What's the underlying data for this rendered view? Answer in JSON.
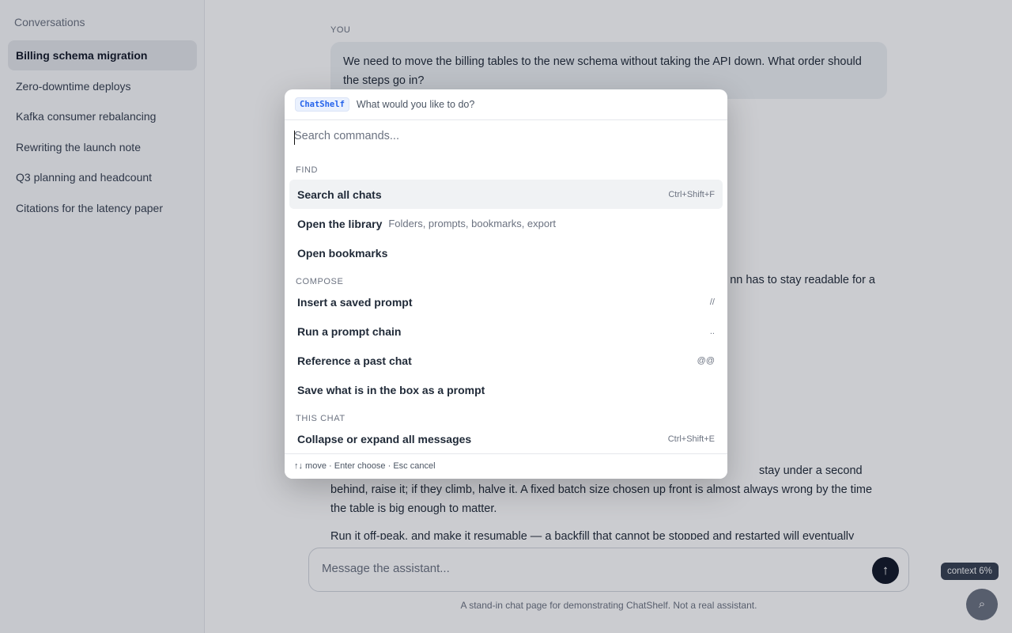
{
  "sidebar": {
    "heading": "Conversations",
    "items": [
      {
        "label": "Billing schema migration",
        "active": true
      },
      {
        "label": "Zero-downtime deploys"
      },
      {
        "label": "Kafka consumer rebalancing"
      },
      {
        "label": "Rewriting the launch note"
      },
      {
        "label": "Q3 planning and headcount"
      },
      {
        "label": "Citations for the latency paper"
      }
    ]
  },
  "chat": {
    "user_role": "YOU",
    "user_message": "We need to move the billing tables to the new schema without taking the API down. What order should the steps go in?",
    "reply_visible_fragment": "nn has to stay readable for a",
    "reply_paragraph_1": "stay under a second behind, raise it; if they climb, halve it. A fixed batch size chosen up front is almost always wrong by the time the table is big enough to matter.",
    "reply_paragraph_2": "Run it off-peak, and make it resumable — a backfill that cannot be stopped and restarted will eventually",
    "composer_placeholder": "Message the assistant...",
    "send_icon": "↑",
    "footer_note": "A stand-in chat page for demonstrating ChatShelf. Not a real assistant.",
    "context_label": "context 6%",
    "fab_icon": "⌕"
  },
  "palette": {
    "brand": "ChatShelf",
    "prompt": "What would you like to do?",
    "search_placeholder": "Search commands...",
    "groups": {
      "find": {
        "title": "FIND",
        "items": [
          {
            "label": "Search all chats",
            "shortcut": "Ctrl+Shift+F"
          },
          {
            "label": "Open the library",
            "hint": "Folders, prompts, bookmarks, export"
          },
          {
            "label": "Open bookmarks"
          }
        ]
      },
      "compose": {
        "title": "COMPOSE",
        "items": [
          {
            "label": "Insert a saved prompt",
            "shortcut": "//"
          },
          {
            "label": "Run a prompt chain",
            "shortcut": ".."
          },
          {
            "label": "Reference a past chat",
            "shortcut": "@@"
          },
          {
            "label": "Save what is in the box as a prompt"
          }
        ]
      },
      "this_chat": {
        "title": "THIS CHAT",
        "items": [
          {
            "label": "Collapse or expand all messages",
            "shortcut": "Ctrl+Shift+E"
          }
        ]
      }
    },
    "footer_hint": "↑↓ move · Enter choose · Esc cancel"
  }
}
